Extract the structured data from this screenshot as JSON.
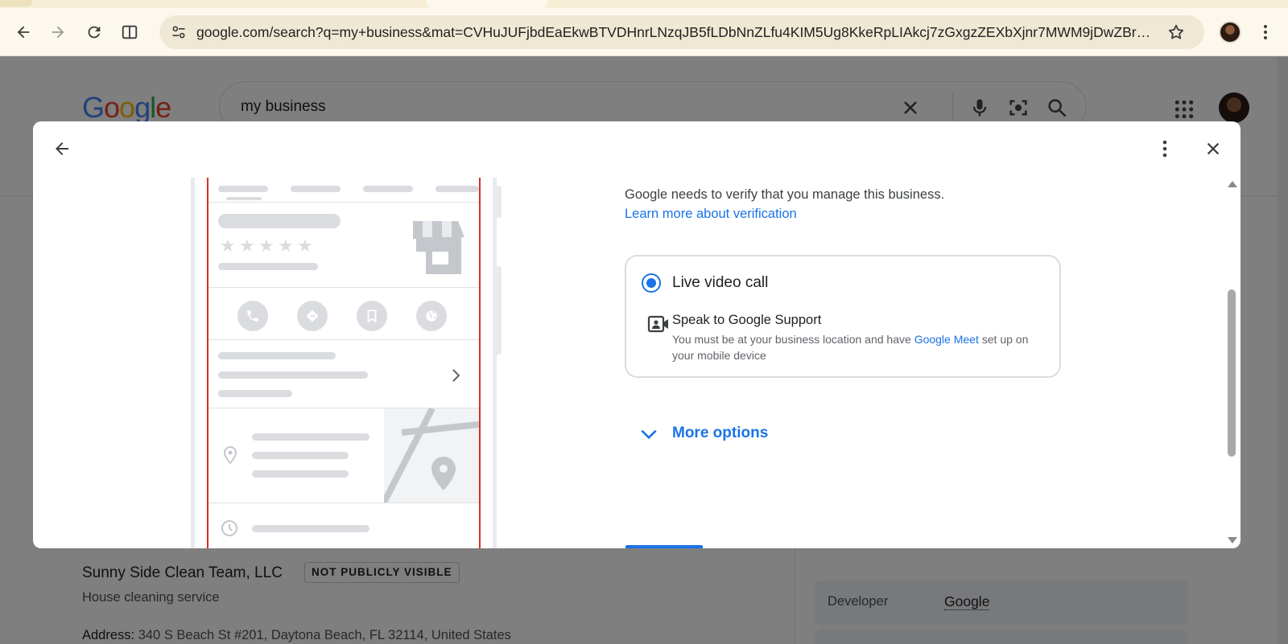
{
  "browser": {
    "url": "google.com/search?q=my+business&mat=CVHuJUFjbdEaEkwBTVDHnrLNzqJB5fLDbNnZLfu4KIM5Ug8KkeRpLIAkcj7zGxgzZEXbXjnr7MWM9jDwZBr20ik0K..."
  },
  "page": {
    "logo": [
      "G",
      "o",
      "o",
      "g",
      "l",
      "e"
    ],
    "search_query": "my business",
    "business": {
      "name": "Sunny Side Clean Team, LLC",
      "badge": "NOT PUBLICLY VISIBLE",
      "category": "House cleaning service",
      "address_label": "Address:",
      "address_value": " 340 S Beach St #201, Daytona Beach, FL 32114, United States"
    },
    "developer": {
      "label": "Developer",
      "value": "Google"
    }
  },
  "dialog": {
    "verify_text": "Google needs to verify that you manage this business.",
    "verify_link": "Learn more about verification",
    "option": {
      "title": "Live video call",
      "selected": true,
      "subtitle": "Speak to Google Support",
      "desc_before": "You must be at your business location and have ",
      "desc_link": "Google Meet",
      "desc_after": " set up on your mobile device"
    },
    "more_options": "More options"
  },
  "colors": {
    "accent": "#1a73e8",
    "scrim": "rgba(0,0,0,0.5)",
    "phone_border": "#d93025"
  },
  "icons": {
    "back": "arrow-left-icon",
    "forward": "arrow-right-icon",
    "reload": "reload-icon",
    "split": "split-view-icon",
    "site_info": "tune-icon",
    "bookmark": "star-icon",
    "menu": "kebab-menu-icon",
    "clear": "close-icon",
    "voice": "mic-icon",
    "lens": "camera-lens-icon",
    "search": "search-icon",
    "apps": "apps-grid-icon",
    "video": "video-call-icon",
    "expand": "chevron-down-icon"
  }
}
